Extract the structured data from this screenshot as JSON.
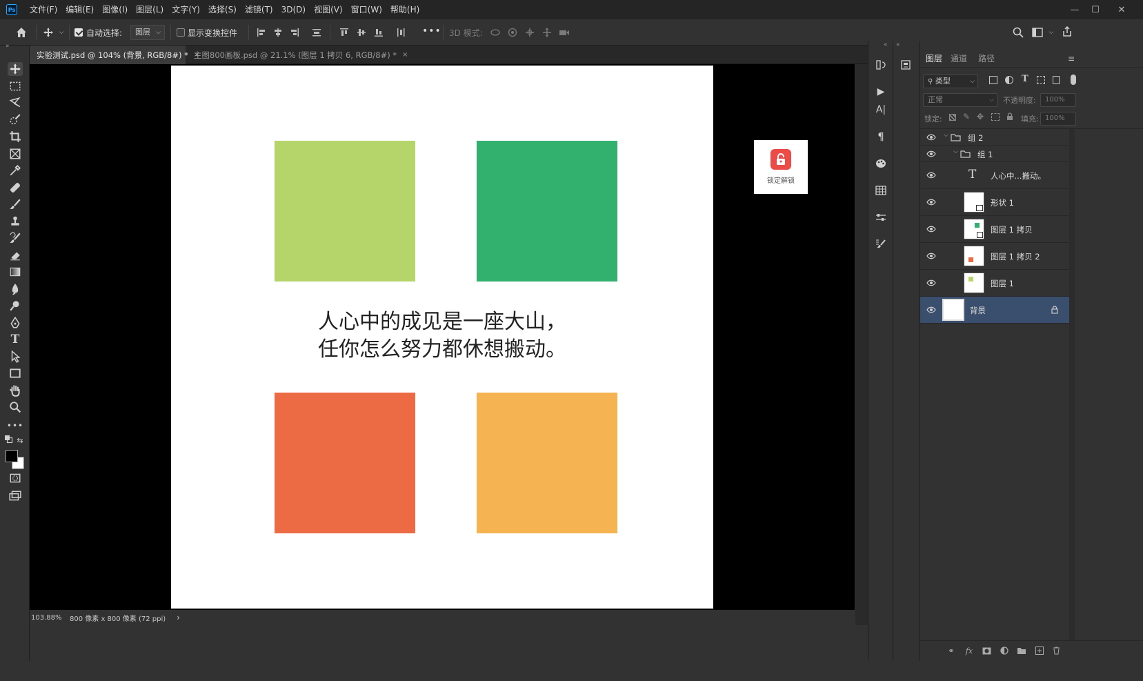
{
  "app": {
    "logo_text": "Ps"
  },
  "menu": [
    "文件(F)",
    "编辑(E)",
    "图像(I)",
    "图层(L)",
    "文字(Y)",
    "选择(S)",
    "滤镜(T)",
    "3D(D)",
    "视图(V)",
    "窗口(W)",
    "帮助(H)"
  ],
  "window_controls": {
    "minimize": "—",
    "maximize": "☐",
    "close": "✕"
  },
  "options": {
    "auto_select_label": "自动选择:",
    "auto_select_checked": true,
    "auto_select_value": "图层",
    "show_transform_label": "显示变换控件",
    "show_transform_checked": false,
    "mode_3d_label": "3D 模式:",
    "more": "•••"
  },
  "tabs": [
    {
      "label": "实验测试.psd @ 104% (背景, RGB/8#) *",
      "active": true,
      "close": "×"
    },
    {
      "label": "主图800画板.psd @ 21.1% (图层 1 拷贝 6, RGB/8#) *",
      "active": false,
      "close": "×"
    }
  ],
  "document": {
    "line1": "人心中的成见是一座大山，",
    "line2": "任你怎么努力都休想搬动。",
    "squares": [
      {
        "name": "square-lime",
        "color": "#b5d56a"
      },
      {
        "name": "square-green",
        "color": "#31b16d"
      },
      {
        "name": "square-orange-red",
        "color": "#ec6a44"
      },
      {
        "name": "square-amber",
        "color": "#f5b451"
      }
    ]
  },
  "lock_popup": {
    "label": "锁定解锁",
    "icon": "lock-icon"
  },
  "status": {
    "zoom": "103.88%",
    "doc_size": "800 像素 x 800 像素 (72 ppi)",
    "arrow": "›"
  },
  "layers_panel": {
    "tabs": [
      "图层",
      "通道",
      "路径"
    ],
    "filter_kind": "类型",
    "blend_mode": "正常",
    "opacity_label": "不透明度:",
    "opacity_value": "100%",
    "lock_label": "锁定:",
    "fill_label": "填充:",
    "fill_value": "100%",
    "layers": [
      {
        "name": "组 2",
        "type": "group",
        "indent": 0
      },
      {
        "name": "组 1",
        "type": "group",
        "indent": 1
      },
      {
        "name": "人心中...搬动。",
        "type": "text",
        "indent": 2
      },
      {
        "name": "形状 1",
        "type": "shape",
        "indent": 2
      },
      {
        "name": "图层 1 拷贝",
        "type": "pixel",
        "indent": 2,
        "accent": "#31b16d"
      },
      {
        "name": "图层 1 拷贝 2",
        "type": "pixel",
        "indent": 2,
        "accent": "#ec6a44"
      },
      {
        "name": "图层 1",
        "type": "pixel",
        "indent": 2,
        "accent": "#b5d56a"
      },
      {
        "name": "背景",
        "type": "background",
        "indent": 0,
        "selected": true,
        "locked": true
      }
    ]
  },
  "colors": {
    "accent_selected_layer": "#3a4f6e",
    "foreground": "#000000",
    "background": "#ffffff"
  }
}
